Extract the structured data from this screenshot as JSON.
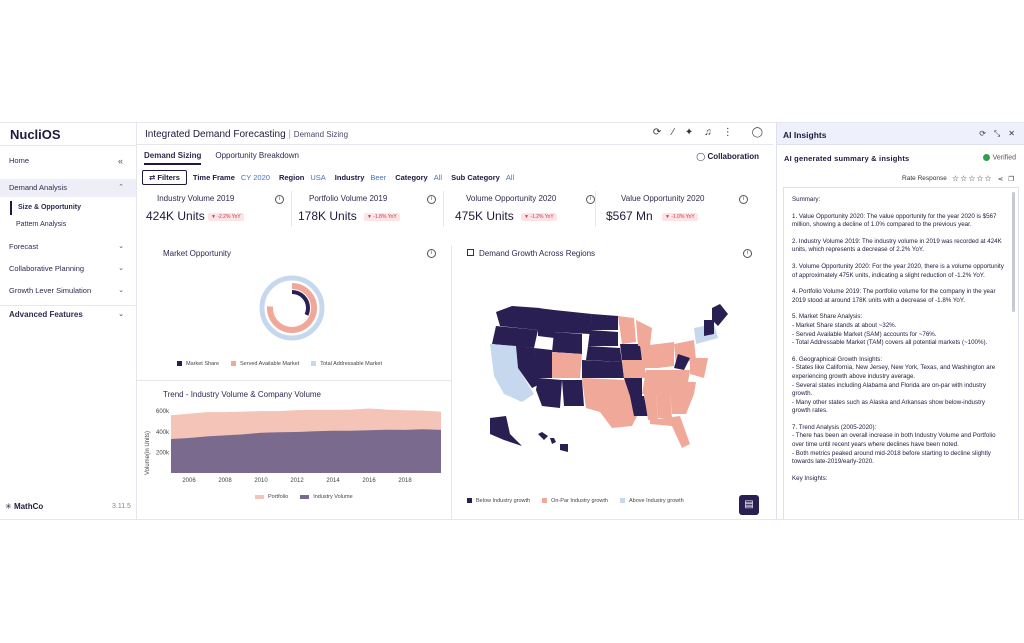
{
  "brand": "NucliOS",
  "sidebar": {
    "home": "Home",
    "collapse_icon": "double-chevron-left",
    "demand_analysis": "Demand Analysis",
    "sub_items": [
      "Size & Opportunity",
      "Pattern Analysis"
    ],
    "forecast": "Forecast",
    "collaborative_planning": "Collaborative Planning",
    "growth_lever": "Growth Lever Simulation",
    "advanced": "Advanced Features",
    "footer_brand": "MathCo",
    "version": "3.11.5"
  },
  "header": {
    "title": "Integrated Demand Forecasting",
    "subtitle": "Demand Sizing"
  },
  "tabs": [
    "Demand Sizing",
    "Opportunity Breakdown"
  ],
  "collaboration": "Collaboration",
  "filters": {
    "button": "Filters",
    "items": [
      {
        "label": "Time Frame",
        "value": "CY 2020"
      },
      {
        "label": "Region",
        "value": "USA"
      },
      {
        "label": "Industry",
        "value": "Beer"
      },
      {
        "label": "Category",
        "value": "All"
      },
      {
        "label": "Sub Category",
        "value": "All"
      }
    ]
  },
  "kpis": [
    {
      "title": "Industry Volume 2019",
      "value": "424K Units",
      "change": "-2.2% YoY"
    },
    {
      "title": "Portfolio Volume 2019",
      "value": "178K Units",
      "change": "-1.8% YoY"
    },
    {
      "title": "Volume Opportunity 2020",
      "value": "475K Units",
      "change": "-1.2% YoY"
    },
    {
      "title": "Value Opportunity 2020",
      "value": "$567 Mn",
      "change": "-1.0% YoY"
    }
  ],
  "market_opportunity": {
    "title": "Market Opportunity",
    "legend": [
      "Market Share",
      "Served Available Market",
      "Total Addressable Market"
    ]
  },
  "trend": {
    "title": "Trend - Industry Volume & Company Volume",
    "legend": [
      "Portfolio",
      "Industry Volume"
    ]
  },
  "map": {
    "title": "Demand Growth Across Regions",
    "legend": [
      "Below Industry growth",
      "On-Par Industry growth",
      "Above Industry growth"
    ]
  },
  "colors": {
    "dark": "#2a1f52",
    "salmon": "#f0a898",
    "light_blue": "#c6d8ee",
    "accent_blue": "#4a72b8"
  },
  "chart_data": [
    {
      "type": "pie",
      "title": "Market Opportunity",
      "series": [
        {
          "name": "Market Share",
          "value": 32
        },
        {
          "name": "Served Available Market",
          "value": 76
        },
        {
          "name": "Total Addressable Market",
          "value": 100
        }
      ]
    },
    {
      "type": "area",
      "title": "Trend - Industry Volume & Company Volume",
      "ylabel": "Volume(in Units)",
      "x": [
        2005,
        2006,
        2007,
        2008,
        2009,
        2010,
        2011,
        2012,
        2013,
        2014,
        2015,
        2016,
        2017,
        2018,
        2019,
        2020
      ],
      "xticks": [
        "2006",
        "2008",
        "2010",
        "2012",
        "2014",
        "2016",
        "2018"
      ],
      "yticks": [
        "200k",
        "400k",
        "600k"
      ],
      "ylim": [
        0,
        640
      ],
      "series": [
        {
          "name": "Portfolio",
          "values": [
            560,
            575,
            590,
            590,
            595,
            600,
            600,
            610,
            612,
            612,
            615,
            625,
            615,
            608,
            605,
            595
          ]
        },
        {
          "name": "Industry Volume",
          "values": [
            330,
            340,
            355,
            365,
            375,
            390,
            395,
            398,
            405,
            410,
            410,
            415,
            420,
            418,
            424,
            418
          ]
        }
      ]
    }
  ],
  "ai": {
    "title": "AI Insights",
    "subtitle": "AI generated summary & insights",
    "verified": "Verified",
    "rate_label": "Rate Response",
    "stars": "☆☆☆☆☆",
    "paragraphs": [
      "Summary:",
      "1. Value Opportunity 2020: The value opportunity for the year 2020 is $567 million, showing a decline of 1.0% compared to the previous year.",
      "2. Industry Volume 2019: The industry volume in 2019 was recorded at 424K units, which represents a decrease of 2.2% YoY.",
      "3. Volume Opportunity 2020: For the year 2020, there is a volume opportunity of approximately 475K units, indicating a slight reduction of -1.2% YoY.",
      "4. Portfolio Volume 2019: The portfolio volume for the company in the year 2019 stood at around 178K units with a decrease of -1.8% YoY.",
      "5. Market Share Analysis:\n- Market Share stands at about ~32%.\n- Served Available Market (SAM) accounts for ~76%.\n- Total Addressable Market (TAM) covers all potential markets (~100%).",
      "6. Geographical Growth Insights:\n- States like California, New Jersey, New York, Texas, and Washington are experiencing growth above industry average.\n- Several states including Alabama and Florida are on-par with industry growth.\n- Many other states such as Alaska and Arkansas show below-industry growth rates.",
      "7. Trend Analysis (2005-2020):\n- There has been an overall increase in both Industry Volume and Portfolio over time until recent years where declines have been noted.\n- Both metrics peaked around mid-2018 before starting to decline slightly towards late-2019/early-2020.",
      "Key Insights:"
    ]
  }
}
